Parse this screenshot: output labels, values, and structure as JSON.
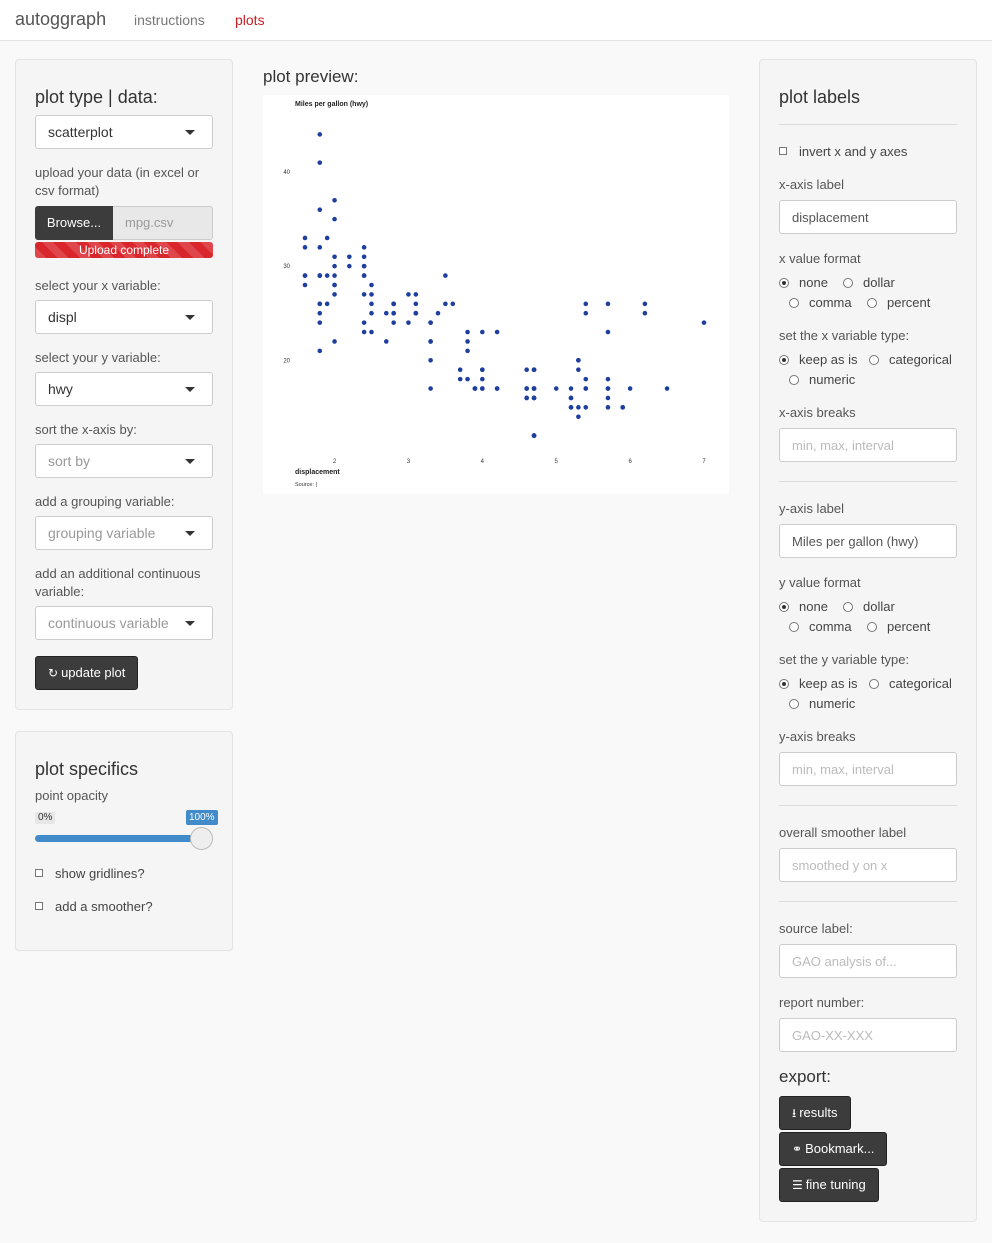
{
  "nav": {
    "brand": "autoggraph",
    "links": [
      "instructions",
      "plots"
    ]
  },
  "left": {
    "title": "plot type | data:",
    "plot_type": "scatterplot",
    "upload_label": "upload your data (in excel or csv format)",
    "browse_label": "Browse...",
    "file_name": "mpg.csv",
    "upload_status": "Upload complete",
    "x_label": "select your x variable:",
    "x_value": "displ",
    "y_label": "select your y variable:",
    "y_value": "hwy",
    "sort_label": "sort the x-axis by:",
    "sort_placeholder": "sort by",
    "group_label": "add a grouping variable:",
    "group_placeholder": "grouping variable",
    "cont_label": "add an additional continuous variable:",
    "cont_placeholder": "continuous variable",
    "update_button": "update plot"
  },
  "specifics": {
    "title": "plot specifics",
    "opacity_label": "point opacity",
    "opacity_min": "0%",
    "opacity_max": "100%",
    "opacity_value": 1.0,
    "gridlines_label": "show gridlines?",
    "smoother_label": "add a smoother?"
  },
  "preview": {
    "title": "plot preview:"
  },
  "chart_data": {
    "type": "scatter",
    "title": "Miles per gallon (hwy)",
    "xlabel": "displacement",
    "source": "Source:  |",
    "color": "#1f3f9e",
    "xlim": [
      1.6,
      7.0
    ],
    "ylim": [
      11,
      45
    ],
    "x_ticks": [
      "2",
      "3",
      "4",
      "5",
      "6",
      "7"
    ],
    "y_ticks": [
      "20",
      "30",
      "40"
    ],
    "points": [
      [
        1.8,
        29
      ],
      [
        1.8,
        29
      ],
      [
        2.0,
        31
      ],
      [
        2.0,
        30
      ],
      [
        2.8,
        26
      ],
      [
        2.8,
        26
      ],
      [
        3.1,
        27
      ],
      [
        1.8,
        26
      ],
      [
        1.8,
        25
      ],
      [
        2.0,
        28
      ],
      [
        2.0,
        27
      ],
      [
        2.8,
        25
      ],
      [
        2.8,
        25
      ],
      [
        3.1,
        25
      ],
      [
        3.1,
        25
      ],
      [
        2.8,
        24
      ],
      [
        3.1,
        25
      ],
      [
        4.2,
        23
      ],
      [
        5.3,
        20
      ],
      [
        5.3,
        15
      ],
      [
        5.3,
        20
      ],
      [
        5.7,
        17
      ],
      [
        6.0,
        17
      ],
      [
        5.7,
        26
      ],
      [
        5.7,
        23
      ],
      [
        6.2,
        26
      ],
      [
        6.2,
        25
      ],
      [
        7.0,
        24
      ],
      [
        5.3,
        19
      ],
      [
        5.3,
        14
      ],
      [
        5.7,
        15
      ],
      [
        6.5,
        17
      ],
      [
        2.4,
        27
      ],
      [
        2.4,
        30
      ],
      [
        3.1,
        26
      ],
      [
        3.5,
        29
      ],
      [
        3.6,
        26
      ],
      [
        2.4,
        24
      ],
      [
        3.0,
        24
      ],
      [
        3.3,
        22
      ],
      [
        3.3,
        22
      ],
      [
        3.3,
        24
      ],
      [
        3.3,
        24
      ],
      [
        3.3,
        17
      ],
      [
        3.8,
        22
      ],
      [
        3.8,
        21
      ],
      [
        3.8,
        23
      ],
      [
        4.0,
        23
      ],
      [
        3.7,
        19
      ],
      [
        3.7,
        18
      ],
      [
        3.9,
        17
      ],
      [
        3.9,
        17
      ],
      [
        4.7,
        19
      ],
      [
        4.7,
        19
      ],
      [
        4.7,
        12
      ],
      [
        5.2,
        17
      ],
      [
        5.2,
        15
      ],
      [
        3.9,
        17
      ],
      [
        4.7,
        17
      ],
      [
        4.7,
        12
      ],
      [
        4.7,
        17
      ],
      [
        5.2,
        16
      ],
      [
        5.7,
        18
      ],
      [
        5.9,
        15
      ],
      [
        4.7,
        16
      ],
      [
        4.7,
        12
      ],
      [
        4.7,
        17
      ],
      [
        4.7,
        17
      ],
      [
        4.7,
        16
      ],
      [
        4.7,
        12
      ],
      [
        5.2,
        15
      ],
      [
        5.2,
        16
      ],
      [
        5.7,
        17
      ],
      [
        5.9,
        15
      ],
      [
        4.6,
        17
      ],
      [
        5.4,
        17
      ],
      [
        5.4,
        18
      ],
      [
        4.0,
        17
      ],
      [
        4.0,
        19
      ],
      [
        4.0,
        17
      ],
      [
        4.0,
        19
      ],
      [
        4.6,
        19
      ],
      [
        5.0,
        17
      ],
      [
        4.2,
        17
      ],
      [
        4.2,
        17
      ],
      [
        4.6,
        16
      ],
      [
        4.6,
        16
      ],
      [
        4.6,
        17
      ],
      [
        5.4,
        15
      ],
      [
        5.4,
        17
      ],
      [
        5.4,
        26
      ],
      [
        5.4,
        25
      ],
      [
        1.8,
        26
      ],
      [
        1.8,
        24
      ],
      [
        1.8,
        21
      ],
      [
        2.0,
        22
      ],
      [
        2.4,
        23
      ],
      [
        2.5,
        23
      ],
      [
        2.5,
        26
      ],
      [
        2.8,
        26
      ],
      [
        1.6,
        28
      ],
      [
        1.6,
        29
      ],
      [
        1.6,
        29
      ],
      [
        1.6,
        33
      ],
      [
        1.6,
        32
      ],
      [
        1.8,
        32
      ],
      [
        1.8,
        29
      ],
      [
        2.0,
        29
      ],
      [
        2.0,
        28
      ],
      [
        2.4,
        29
      ],
      [
        2.4,
        29
      ],
      [
        3.0,
        27
      ],
      [
        3.5,
        26
      ],
      [
        2.2,
        31
      ],
      [
        2.2,
        30
      ],
      [
        2.4,
        30
      ],
      [
        2.4,
        32
      ],
      [
        2.4,
        31
      ],
      [
        2.5,
        25
      ],
      [
        2.5,
        27
      ],
      [
        2.7,
        25
      ],
      [
        2.7,
        22
      ],
      [
        3.4,
        25
      ],
      [
        4.0,
        18
      ],
      [
        4.7,
        19
      ],
      [
        4.7,
        16
      ],
      [
        5.7,
        16
      ],
      [
        1.8,
        36
      ],
      [
        1.8,
        44
      ],
      [
        1.8,
        41
      ],
      [
        1.9,
        29
      ],
      [
        1.9,
        26
      ],
      [
        1.9,
        33
      ],
      [
        2.0,
        35
      ],
      [
        2.0,
        37
      ],
      [
        2.5,
        28
      ],
      [
        2.8,
        26
      ],
      [
        3.3,
        20
      ],
      [
        3.8,
        18
      ]
    ]
  },
  "right": {
    "title": "plot labels",
    "invert_label": "invert x and y axes",
    "xaxis_label": "x-axis label",
    "xaxis_value": "displacement",
    "xformat_label": "x value format",
    "format_options": [
      "none",
      "dollar",
      "comma",
      "percent"
    ],
    "xtype_label": "set the x variable type:",
    "type_options": [
      "keep as is",
      "categorical",
      "numeric"
    ],
    "xbreaks_label": "x-axis breaks",
    "breaks_placeholder": "min, max, interval",
    "yaxis_label": "y-axis label",
    "yaxis_value": "Miles per gallon (hwy)",
    "yformat_label": "y value format",
    "ytype_label": "set the y variable type:",
    "ybreaks_label": "y-axis breaks",
    "smoother_label": "overall smoother label",
    "smoother_placeholder": "smoothed y on x",
    "source_label": "source label:",
    "source_placeholder": "GAO analysis of...",
    "report_label": "report number:",
    "report_placeholder": "GAO-XX-XXX",
    "export_title": "export:",
    "results_button": "results",
    "bookmark_button": "Bookmark...",
    "tuning_button": "fine tuning"
  }
}
